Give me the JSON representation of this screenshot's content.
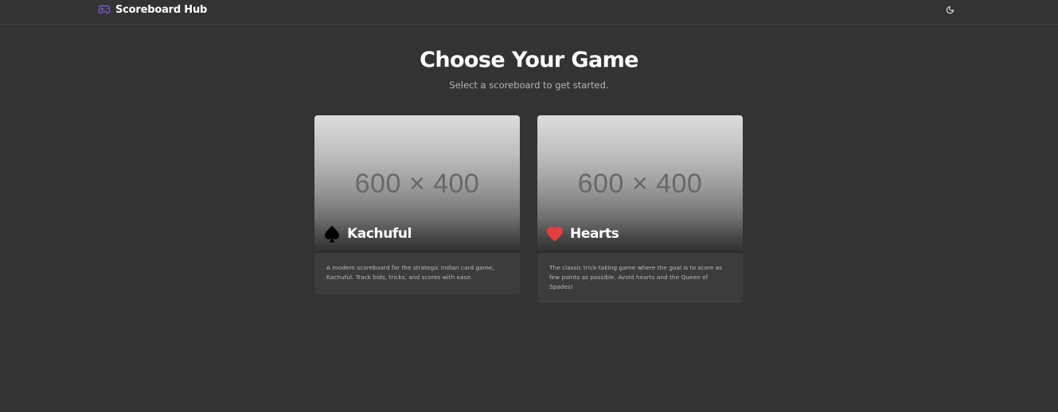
{
  "header": {
    "app_name": "Scoreboard Hub",
    "brand_icon": "gamepad-icon",
    "brand_color": "#7c5cd6",
    "theme_toggle_icon": "moon-icon"
  },
  "hero": {
    "title": "Choose Your Game",
    "subtitle": "Select a scoreboard to get started."
  },
  "games": [
    {
      "name": "Kachuful",
      "suit_icon": "spade-icon",
      "suit_color": "#000000",
      "image_placeholder": "600 × 400",
      "description": "A modern scoreboard for the strategic Indian card game, Kachuful. Track bids, tricks, and scores with ease."
    },
    {
      "name": "Hearts",
      "suit_icon": "heart-icon",
      "suit_color": "#e53e3e",
      "image_placeholder": "600 × 400",
      "description": "The classic trick-taking game where the goal is to score as few points as possible. Avoid hearts and the Queen of Spades!"
    }
  ]
}
